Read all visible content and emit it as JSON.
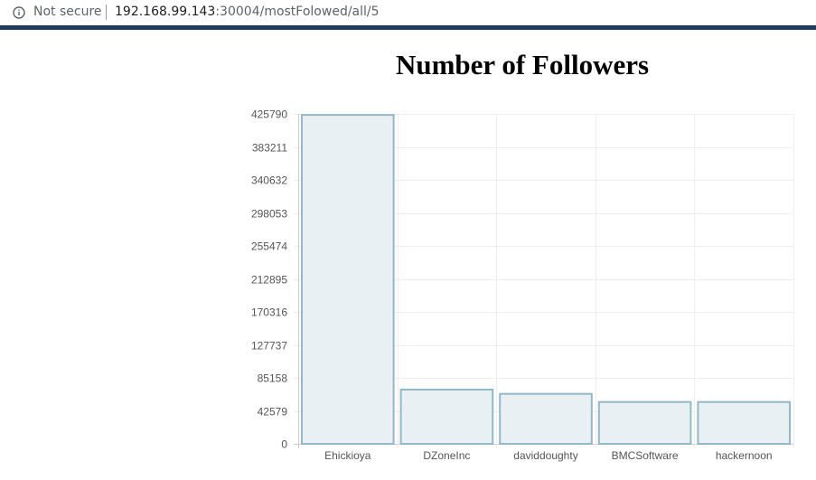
{
  "browser": {
    "security_label": "Not secure",
    "url_host": "192.168.99.143",
    "url_path": ":30004/mostFolowed/all/5"
  },
  "chart_data": {
    "type": "bar",
    "title": "Number of Followers",
    "categories": [
      "Ehickioya",
      "DZoneInc",
      "daviddoughty",
      "BMCSoftware",
      "hackernoon"
    ],
    "values": [
      424500,
      70000,
      64500,
      54000,
      54000
    ],
    "yticks": [
      0,
      42579,
      85158,
      127737,
      170316,
      212895,
      255474,
      298053,
      340632,
      383211,
      425790
    ],
    "ylim": [
      0,
      425790
    ],
    "xlabel": "",
    "ylabel": "",
    "grid": true,
    "legend": "none",
    "bar_fill": "#e8f0f4",
    "bar_stroke": "#93b8c9",
    "grid_color": "#eeeeee"
  }
}
